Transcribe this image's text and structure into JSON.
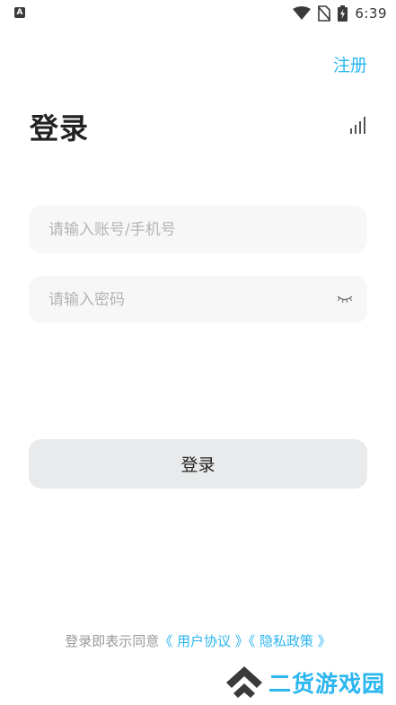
{
  "status_bar": {
    "app_icon_letter": "A",
    "time": "6:39",
    "icons": [
      "wifi-icon",
      "no-sim-icon",
      "battery-charging-icon"
    ]
  },
  "header": {
    "register_label": "注册",
    "title": "登录",
    "signal_icon": "signal-bars-icon"
  },
  "form": {
    "account_placeholder": "请输入账号/手机号",
    "account_value": "",
    "password_placeholder": "请输入密码",
    "password_value": "",
    "password_toggle_icon": "eye-closed-icon",
    "login_label": "登录"
  },
  "agreement": {
    "prefix": "登录即表示同意",
    "user_agreement": "《 用户协议 》",
    "privacy_policy": "《 隐私政策 》"
  },
  "watermark": {
    "text": "二货游戏园"
  },
  "colors": {
    "accent": "#2bb6f0",
    "input_bg": "#f7f7f8",
    "button_bg": "#e9eaeb",
    "title": "#222222",
    "placeholder": "#b4b4b4"
  }
}
